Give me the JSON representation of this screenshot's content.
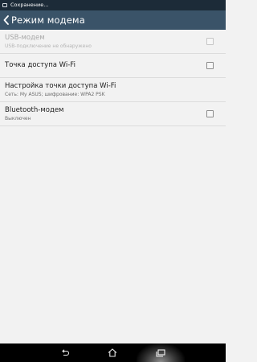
{
  "status_bar": {
    "text": "Сохранение..."
  },
  "action_bar": {
    "title": "Режим модема",
    "back_icon": "chevron-left-icon"
  },
  "settings": [
    {
      "title": "USB-модем",
      "subtitle": "USB-подключение не обнаружено",
      "checked": false,
      "enabled": false
    },
    {
      "title": "Точка доступа Wi-Fi",
      "subtitle": "",
      "checked": false,
      "enabled": true
    },
    {
      "title": "Настройка точки доступа Wi-Fi",
      "subtitle": "Сеть: My ASUS; шифрование: WPA2 PSK",
      "checked": null,
      "enabled": true
    },
    {
      "title": "Bluetooth-модем",
      "subtitle": "Выключен",
      "checked": false,
      "enabled": true
    }
  ],
  "nav_bar": {
    "buttons": [
      "back-icon",
      "home-icon",
      "recent-apps-icon"
    ]
  },
  "colors": {
    "status_bar": "#1c2b38",
    "action_bar": "#3a5368",
    "background": "#f2f2f2",
    "nav_bar": "#000000"
  }
}
